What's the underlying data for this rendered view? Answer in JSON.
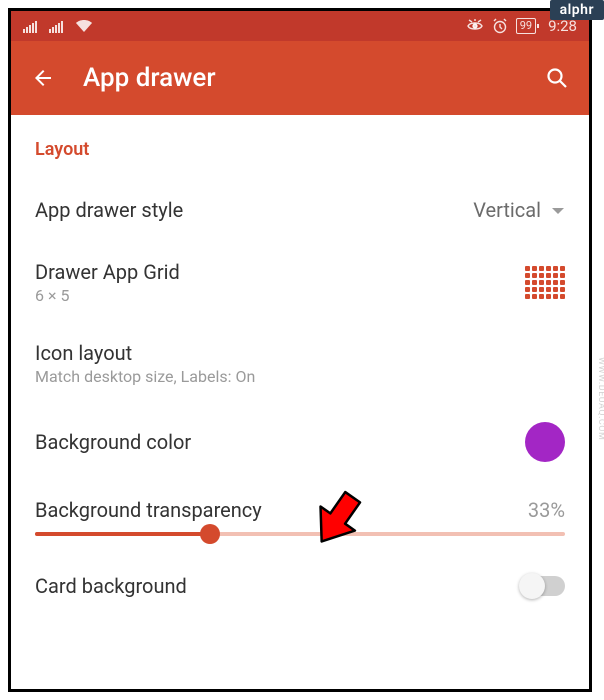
{
  "badge": "alphr",
  "watermark": "WWW.DEUAQ.COM",
  "statusbar": {
    "battery": "99",
    "time": "9:28"
  },
  "appbar": {
    "title": "App drawer"
  },
  "section": {
    "header": "Layout"
  },
  "rows": {
    "style": {
      "label": "App drawer style",
      "value": "Vertical"
    },
    "grid": {
      "label": "Drawer App Grid",
      "sub": "6 × 5"
    },
    "iconlayout": {
      "label": "Icon layout",
      "sub": "Match desktop size, Labels: On"
    },
    "bgcolor": {
      "label": "Background color",
      "color": "#a326c5"
    },
    "transparency": {
      "label": "Background transparency",
      "value": "33%",
      "percent": 33
    },
    "cardbg": {
      "label": "Card background",
      "on": false
    }
  }
}
